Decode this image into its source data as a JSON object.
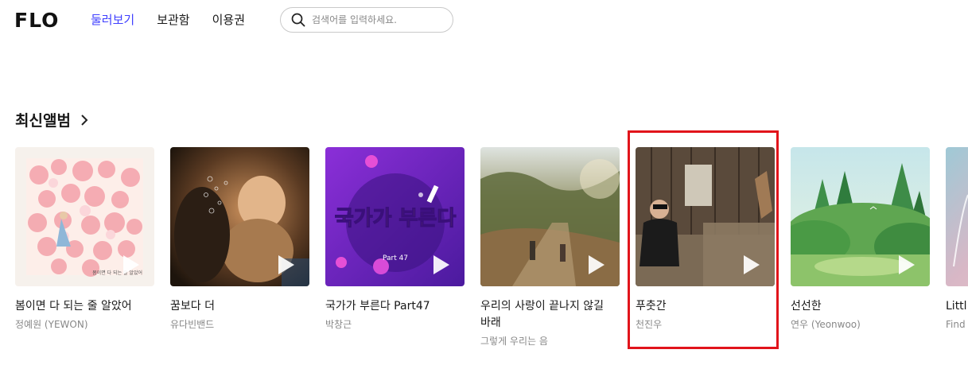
{
  "header": {
    "logo": "FLO",
    "nav": [
      {
        "label": "둘러보기",
        "active": true
      },
      {
        "label": "보관함",
        "active": false
      },
      {
        "label": "이용권",
        "active": false
      }
    ],
    "search_placeholder": "검색어를 입력하세요."
  },
  "section": {
    "title": "최신앨범"
  },
  "albums": [
    {
      "title": "봄이면 다 되는 줄 알았어",
      "artist": "정예원 (YEWON)"
    },
    {
      "title": "꿈보다 더",
      "artist": "유다빈밴드"
    },
    {
      "title": "국가가 부른다 Part47",
      "artist": "박창근",
      "cover_text": "국가가 부른다",
      "cover_sub": "Part 47"
    },
    {
      "title": "우리의 사랑이 끝나지 않길 바래",
      "artist": "그렇게 우리는 음"
    },
    {
      "title": "푸춧간",
      "artist": "천진우"
    },
    {
      "title": "선선한",
      "artist": "연우 (Yeonwoo)"
    },
    {
      "title": "Littl",
      "artist": "Find"
    }
  ],
  "colors": {
    "accent": "#3f3fff",
    "highlight": "#e1141b"
  }
}
